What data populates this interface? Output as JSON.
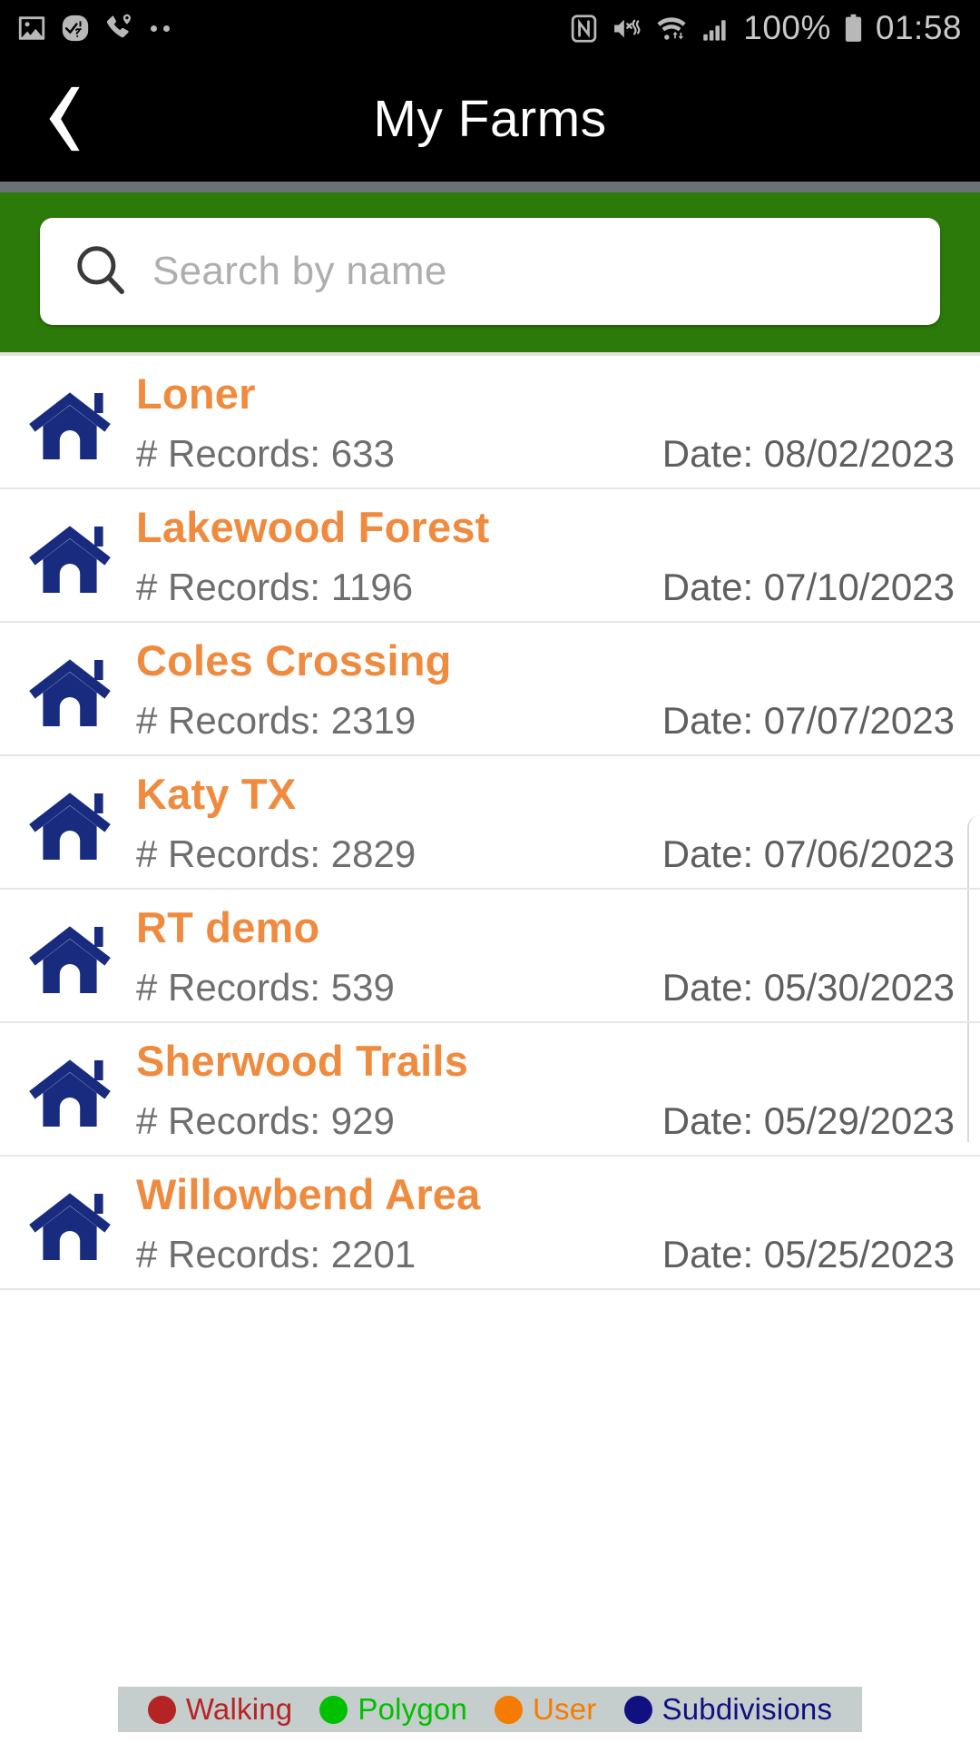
{
  "statusbar": {
    "left_icons": [
      "image-icon",
      "question-check-icon",
      "call-location-icon",
      "more-dots-icon"
    ],
    "right_icons": [
      "nfc-icon",
      "vibrate-mute-icon",
      "wifi-icon",
      "signal-icon",
      "battery-icon"
    ],
    "battery_percent": "100%",
    "clock": "01:58"
  },
  "titlebar": {
    "back_label": "back-chevron",
    "title": "My Farms"
  },
  "search": {
    "placeholder": "Search by name",
    "value": "",
    "icon": "search-icon",
    "background_color": "#2c7a09"
  },
  "list": {
    "row_icon": "home-icon",
    "rows": [
      {
        "name": "Loner",
        "records": "# Records: 633",
        "date": "Date: 08/02/2023"
      },
      {
        "name": "Lakewood Forest",
        "records": "# Records: 1196",
        "date": "Date: 07/10/2023"
      },
      {
        "name": "Coles Crossing",
        "records": "# Records: 2319",
        "date": "Date: 07/07/2023"
      },
      {
        "name": "Katy TX",
        "records": "# Records: 2829",
        "date": "Date: 07/06/2023"
      },
      {
        "name": "RT demo",
        "records": "# Records: 539",
        "date": "Date: 05/30/2023"
      },
      {
        "name": "Sherwood Trails",
        "records": "# Records: 929",
        "date": "Date: 05/29/2023"
      },
      {
        "name": "Willowbend Area",
        "records": "# Records: 2201",
        "date": "Date: 05/25/2023"
      }
    ]
  },
  "legend": {
    "items": [
      {
        "label": "Walking",
        "color": "#b52424"
      },
      {
        "label": "Polygon",
        "color": "#00c000"
      },
      {
        "label": "User",
        "color": "#f57c00"
      },
      {
        "label": "Subdivisions",
        "color": "#101080"
      }
    ]
  },
  "colors": {
    "accent_orange": "#ef8b3f",
    "house_blue": "#192b7e",
    "header_green": "#2c7a09",
    "bar_black": "#000000"
  }
}
